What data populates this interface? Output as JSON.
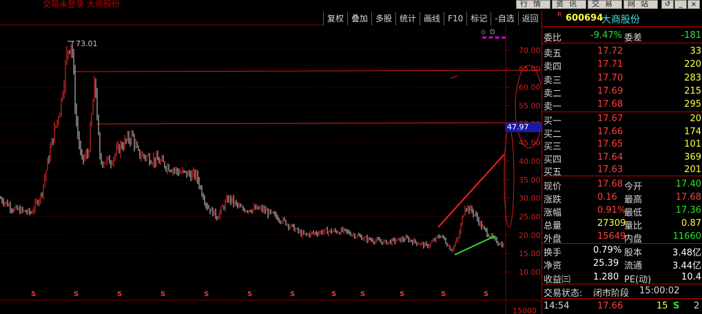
{
  "window": {
    "title": "交易未登录  大商股份",
    "tabs": [
      "行情",
      "资讯",
      "交易",
      "网站"
    ],
    "controls": [
      "↺",
      "_",
      "×"
    ]
  },
  "toolbar": {
    "buttons": [
      "复权",
      "叠加",
      "多股",
      "统计",
      "画线",
      "F10",
      "标记",
      "-自选",
      "返回"
    ],
    "mini_icons": [
      "◇",
      "⊡"
    ]
  },
  "chart": {
    "y_ticks": [
      "70.00",
      "65.00",
      "60.00",
      "55.00",
      "50.00",
      "45.00",
      "40.00",
      "35.00",
      "30.00",
      "25.00",
      "20.00",
      "15.00",
      "10.00"
    ],
    "high_label": "73.01",
    "current_tag": "47.97",
    "volume_tick": "15000",
    "marker": "S",
    "colors": {
      "up": "#ff3030",
      "down": "#d8d8d8",
      "grid": "#800000",
      "support": "#30e030",
      "resist": "#ff2020"
    }
  },
  "quote": {
    "r_mark": "R",
    "code": "600694",
    "name": "大商股份",
    "weibi_label": "委比",
    "weibi": "-9.47%",
    "weicha_label": "委差",
    "weicha": "-181",
    "asks": [
      {
        "label": "卖五",
        "price": "17.72",
        "vol": "33"
      },
      {
        "label": "卖四",
        "price": "17.71",
        "vol": "220"
      },
      {
        "label": "卖三",
        "price": "17.70",
        "vol": "283"
      },
      {
        "label": "卖二",
        "price": "17.69",
        "vol": "215"
      },
      {
        "label": "卖一",
        "price": "17.68",
        "vol": "295"
      }
    ],
    "bids": [
      {
        "label": "买一",
        "price": "17.67",
        "vol": "20"
      },
      {
        "label": "买二",
        "price": "17.66",
        "vol": "174"
      },
      {
        "label": "买三",
        "price": "17.65",
        "vol": "101"
      },
      {
        "label": "买四",
        "price": "17.64",
        "vol": "369"
      },
      {
        "label": "买五",
        "price": "17.63",
        "vol": "201"
      }
    ],
    "stats": [
      {
        "l1": "现价",
        "v1": "17.68",
        "c1": "red",
        "l2": "今开",
        "v2": "17.40",
        "c2": "grn"
      },
      {
        "l1": "涨跌",
        "v1": "0.16",
        "c1": "red",
        "l2": "最高",
        "v2": "17.68",
        "c2": "red"
      },
      {
        "l1": "涨幅",
        "v1": "0.91%",
        "c1": "red",
        "l2": "最低",
        "v2": "17.36",
        "c2": "grn"
      },
      {
        "l1": "总量",
        "v1": "27309",
        "c1": "yel",
        "l2": "量比",
        "v2": "0.87",
        "c2": "yel"
      },
      {
        "l1": "外盘",
        "v1": "15649",
        "c1": "red",
        "l2": "内盘",
        "v2": "11660",
        "c2": "grn"
      }
    ],
    "fund": [
      {
        "l1": "换手",
        "v1": "0.79%",
        "l2": "股本",
        "v2": "3.48亿"
      },
      {
        "l1": "净资",
        "v1": "25.39",
        "l2": "流通",
        "v2": "3.44亿"
      },
      {
        "l1": "收益㈢",
        "v1": "1.280",
        "l2": "PE(动)",
        "v2": "10.4"
      }
    ],
    "status_label": "交易状态:",
    "status_value": "闭市阶段",
    "status_time": "15:00:02",
    "tick": {
      "time": "14:54",
      "price": "17.66",
      "vol": "15",
      "flag": "S",
      "extra": "2"
    }
  }
}
